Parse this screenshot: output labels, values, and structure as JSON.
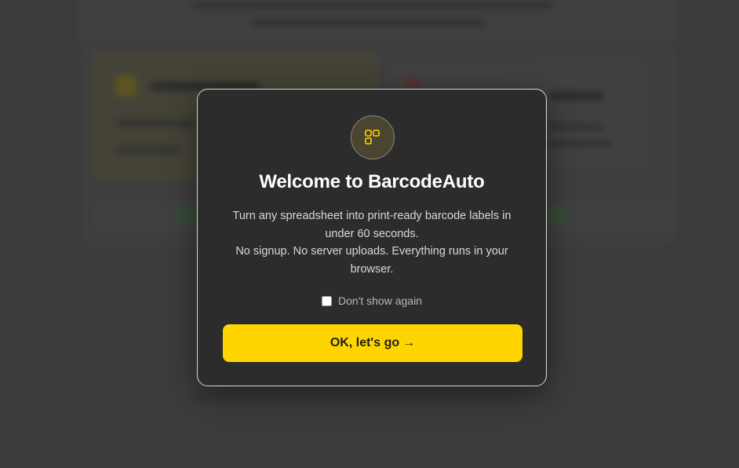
{
  "modal": {
    "logo_icon": "grid-squares-icon",
    "title": "Welcome to BarcodeAuto",
    "description_lines": [
      "Turn any spreadsheet into print-ready barcode labels in",
      "under 60 seconds.",
      "No signup. No server uploads. Everything runs in your",
      "browser."
    ],
    "checkbox_label": "Don't show again",
    "checkbox_checked": false,
    "cta_label": "OK, let's go",
    "cta_arrow": "→"
  },
  "colors": {
    "accent": "#ffd500",
    "modal_bg": "#2c2c2c",
    "backdrop": "#484848"
  }
}
